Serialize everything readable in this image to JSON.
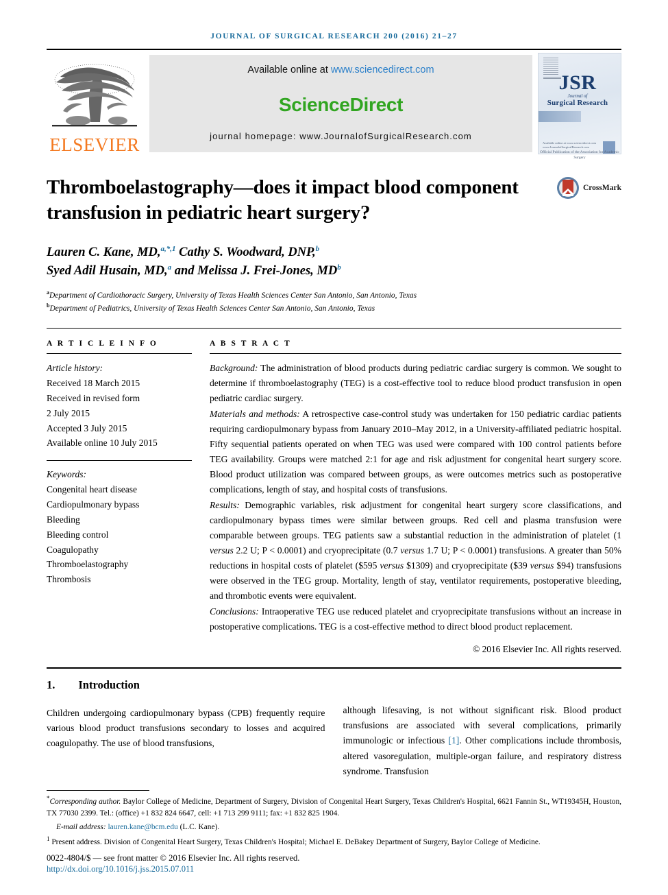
{
  "running_head": "JOURNAL OF SURGICAL RESEARCH 200 (2016) 21–27",
  "masthead": {
    "publisher": "ELSEVIER",
    "available_prefix": "Available online at ",
    "available_url": "www.sciencedirect.com",
    "sciencedirect_logo": "ScienceDirect",
    "homepage": "journal homepage: www.JournalofSurgicalResearch.com",
    "cover": {
      "main": "JSR",
      "journal_of": "Journal of",
      "subtitle": "Surgical Research",
      "note": "Official Publication of the\nAssociation for Academic Surgery",
      "footer": "Available online at www.sciencedirect.com\nwww.JournalofSurgicalResearch.com"
    }
  },
  "article": {
    "title": "Thromboelastography—does it impact blood component transfusion in pediatric heart surgery?",
    "crossmark_label": "CrossMark",
    "authors_line1": "Lauren C. Kane, MD,",
    "authors_line1_sup": "a,*,1",
    "authors_line1_b": " Cathy S. Woodward, DNP,",
    "authors_line1_sup_b": "b",
    "authors_line2": "Syed Adil Husain, MD,",
    "authors_line2_sup": "a",
    "authors_line2_b": " and Melissa J. Frei-Jones, MD",
    "authors_line2_sup_b": "b",
    "affiliation_a_mark": "a",
    "affiliation_a": "Department of Cardiothoracic Surgery, University of Texas Health Sciences Center San Antonio, San Antonio, Texas",
    "affiliation_b_mark": "b",
    "affiliation_b": "Department of Pediatrics, University of Texas Health Sciences Center San Antonio, San Antonio, Texas"
  },
  "article_info": {
    "heading": "A R T I C L E   I N F O",
    "history_label": "Article history:",
    "history": [
      "Received 18 March 2015",
      "Received in revised form",
      "2 July 2015",
      "Accepted 3 July 2015",
      "Available online 10 July 2015"
    ],
    "keywords_label": "Keywords:",
    "keywords": [
      "Congenital heart disease",
      "Cardiopulmonary bypass",
      "Bleeding",
      "Bleeding control",
      "Coagulopathy",
      "Thromboelastography",
      "Thrombosis"
    ]
  },
  "abstract": {
    "heading": "A B S T R A C T",
    "background_label": "Background:",
    "background_text": " The administration of blood products during pediatric cardiac surgery is common. We sought to determine if thromboelastography (TEG) is a cost-effective tool to reduce blood product transfusion in open pediatric cardiac surgery.",
    "methods_label": "Materials and methods:",
    "methods_text": " A retrospective case-control study was undertaken for 150 pediatric cardiac patients requiring cardiopulmonary bypass from January 2010–May 2012, in a University-affiliated pediatric hospital. Fifty sequential patients operated on when TEG was used were compared with 100 control patients before TEG availability. Groups were matched 2:1 for age and risk adjustment for congenital heart surgery score. Blood product utilization was compared between groups, as were outcomes metrics such as postoperative complications, length of stay, and hospital costs of transfusions.",
    "results_label": "Results:",
    "results_text_1": " Demographic variables, risk adjustment for congenital heart surgery score classifications, and cardiopulmonary bypass times were similar between groups. Red cell and plasma transfusion were comparable between groups. TEG patients saw a substantial reduction in the administration of platelet (1 ",
    "results_versus_1": "versus",
    "results_text_2": " 2.2 U; P < 0.0001) and cryoprecipitate (0.7 ",
    "results_versus_2": "versus",
    "results_text_3": " 1.7 U; P < 0.0001) transfusions. A greater than 50% reductions in hospital costs of platelet ($595 ",
    "results_versus_3": "versus",
    "results_text_4": " $1309) and cryoprecipitate ($39 ",
    "results_versus_4": "versus",
    "results_text_5": " $94) transfusions were observed in the TEG group. Mortality, length of stay, ventilator requirements, postoperative bleeding, and thrombotic events were equivalent.",
    "conclusions_label": "Conclusions:",
    "conclusions_text": " Intraoperative TEG use reduced platelet and cryoprecipitate transfusions without an increase in postoperative complications. TEG is a cost-effective method to direct blood product replacement.",
    "copyright": "© 2016 Elsevier Inc. All rights reserved."
  },
  "introduction": {
    "number": "1.",
    "heading": "Introduction",
    "col1_text": "Children undergoing cardiopulmonary bypass (CPB) frequently require various blood product transfusions secondary to losses and acquired coagulopathy. The use of blood transfusions,",
    "col2_text_a": "although lifesaving, is not without significant risk. Blood product transfusions are associated with several complications, primarily immunologic or infectious ",
    "col2_ref": "[1]",
    "col2_text_b": ". Other complications include thrombosis, altered vasoregulation, multiple-organ failure, and respiratory distress syndrome. Transfusion"
  },
  "footnotes": {
    "corresponding_mark": "*",
    "corresponding_label": "Corresponding author.",
    "corresponding_text": " Baylor College of Medicine, Department of Surgery, Division of Congenital Heart Surgery, Texas Children's Hospital, 6621 Fannin St., WT19345H, Houston, TX 77030 2399. Tel.: (office) +1 832 824 6647, cell: +1 713 299 9111; fax: +1 832 825 1904.",
    "email_label": "E-mail address: ",
    "email": "lauren.kane@bcm.edu",
    "email_suffix": " (L.C. Kane).",
    "present_mark": "1",
    "present_text": " Present address. Division of Congenital Heart Surgery, Texas Children's Hospital; Michael E. DeBakey Department of Surgery, Baylor College of Medicine.",
    "issn": "0022-4804/$ — see front matter © 2016 Elsevier Inc. All rights reserved.",
    "doi": "http://dx.doi.org/10.1016/j.jss.2015.07.011"
  },
  "colors": {
    "accent_blue": "#1a6c9c",
    "link_blue": "#2a7fc9",
    "sciencedirect_green": "#31a521",
    "elsevier_orange": "#f47920",
    "band_gray": "#e6e6e6"
  }
}
